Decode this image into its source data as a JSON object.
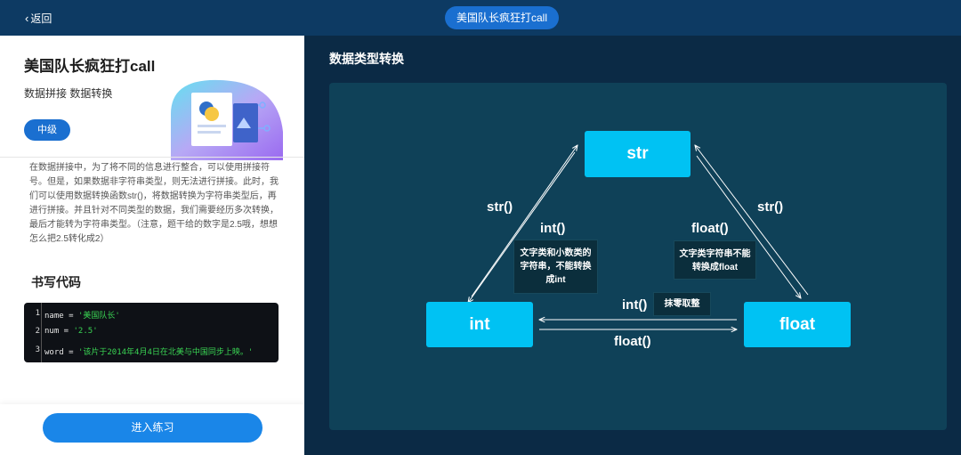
{
  "header": {
    "back_label": "返回",
    "title": "美国队长疯狂打call"
  },
  "course": {
    "title": "美国队长疯狂打call",
    "tags": "数据拼接 数据转换",
    "level": "中级",
    "description": "在数据拼接中，为了将不同的信息进行整合，可以使用拼接符号。但是，如果数据非字符串类型，则无法进行拼接。此时，我们可以使用数据转换函数str()，将数据转换为字符串类型后，再进行拼接。并且针对不同类型的数据，我们需要经历多次转换，最后才能转为字符串类型。（注意，题干给的数字是2.5哦，想想怎么把2.5转化成2）",
    "code_heading": "书写代码",
    "code_lines": [
      {
        "num": "1",
        "code": "name = ",
        "string": "'美国队长'"
      },
      {
        "num": "2",
        "code": "num = ",
        "string": "'2.5'"
      },
      {
        "num": "3",
        "code": "word = ",
        "string": "'该片于2014年4月4日在北美与中国同步上映。'"
      }
    ],
    "start_button": "进入练习"
  },
  "panel": {
    "title": "数据类型转换",
    "nodes": {
      "str": "str",
      "int": "int",
      "float": "float"
    },
    "labels": {
      "left_str": "str()",
      "left_int": "int()",
      "right_float": "float()",
      "right_str": "str()",
      "bottom_int": "int()",
      "bottom_float": "float()"
    },
    "notes": {
      "str_to_int": "文字类和小数类的字符串，不能转换成int",
      "str_to_float": "文字类字符串不能转换成float",
      "float_to_int": "抹零取整"
    }
  }
}
